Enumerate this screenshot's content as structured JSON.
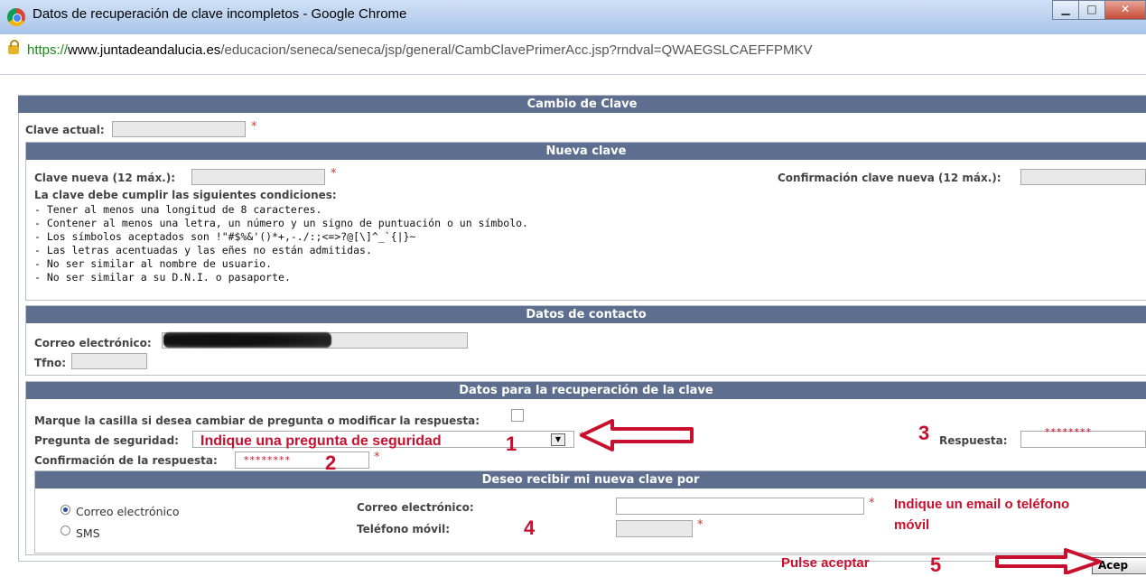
{
  "window": {
    "title": "Datos de recuperación de clave incompletos - Google Chrome",
    "url_scheme": "https://",
    "url_domain": "www.juntadeandalucia.es",
    "url_path": "/educacion/seneca/seneca/jsp/general/CambClavePrimerAcc.jsp?rndval=QWAEGSLCAEFFPMKV"
  },
  "form": {
    "main_header": "Cambio de Clave",
    "current_password_label": "Clave actual:",
    "required_mark": "*",
    "new_password": {
      "header": "Nueva clave",
      "new_label": "Clave nueva (12 máx.):",
      "confirm_label": "Confirmación clave nueva (12 máx.):",
      "rules_title": "La clave debe cumplir las siguientes condiciones:",
      "rules": [
        "- Tener al menos una longitud de 8 caracteres.",
        "- Contener al menos una letra, un número y un signo de puntuación o un símbolo.",
        "- Los símbolos aceptados son !\"#$%&'()*+,-./:;<=>?@[\\]^_`{|}~",
        "- Las letras acentuadas y las eñes no están admitidas.",
        "- No ser similar al nombre de usuario.",
        "- No ser similar a su D.N.I. o pasaporte."
      ]
    },
    "contact": {
      "header": "Datos de contacto",
      "email_label": "Correo electrónico:",
      "phone_label": "Tfno:"
    },
    "recovery": {
      "header": "Datos para la recuperación de la clave",
      "checkbox_label": "Marque la casilla si desea cambiar de pregunta o modificar la respuesta:",
      "question_label": "Pregunta de seguridad:",
      "question_value": "Indique una pregunta de seguridad",
      "answer_label": "Respuesta:",
      "answer_value": "********",
      "confirm_answer_label": "Confirmación de la respuesta:",
      "confirm_answer_value": "********"
    },
    "delivery": {
      "header": "Deseo recibir mi nueva clave por",
      "option_email": "Correo electrónico",
      "option_sms": "SMS",
      "selected": "Correo electrónico",
      "email_label": "Correo electrónico:",
      "mobile_label": "Teléfono móvil:"
    },
    "accept_button": "Acep"
  },
  "annotations": {
    "step1": "1",
    "step2": "2",
    "step3": "3",
    "step4": "4",
    "step5": "5",
    "email_or_phone_line1": "Indique un email o teléfono",
    "email_or_phone_line2": "móvil",
    "press_accept": "Pulse aceptar",
    "color": "#c8102e"
  }
}
